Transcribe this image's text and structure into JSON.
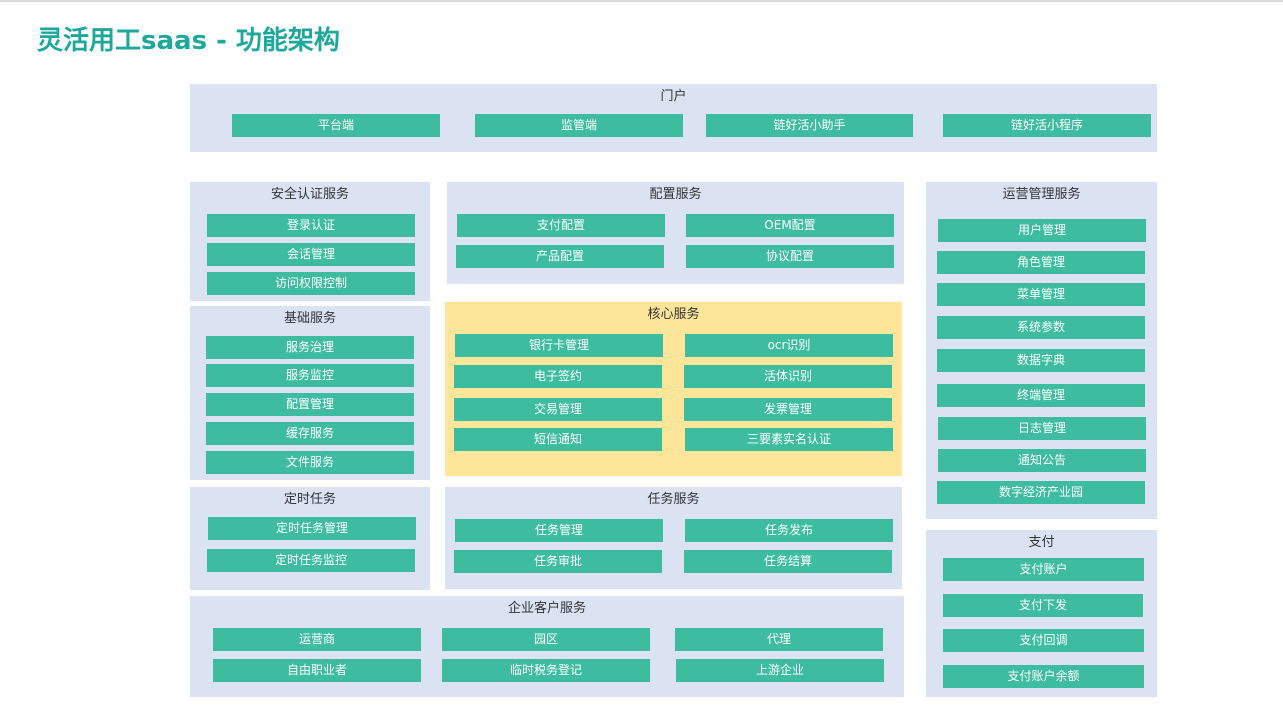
{
  "title": "灵活用工saas - 功能架构",
  "colors": {
    "title": "#1ea89c",
    "panel": "#dbe3f3",
    "core_panel": "#fde69a",
    "module": "#3dbca0"
  },
  "portal": {
    "title": "门户",
    "items": [
      "平台端",
      "监管端",
      "链好活小助手",
      "链好活小程序"
    ]
  },
  "security": {
    "title": "安全认证服务",
    "items": [
      "登录认证",
      "会话管理",
      "访问权限控制"
    ]
  },
  "config": {
    "title": "配置服务",
    "items": [
      "支付配置",
      "OEM配置",
      "产品配置",
      "协议配置"
    ]
  },
  "ops": {
    "title": "运营管理服务",
    "items": [
      "用户管理",
      "角色管理",
      "菜单管理",
      "系统参数",
      "数据字典",
      "终端管理",
      "日志管理",
      "通知公告",
      "数字经济产业园"
    ]
  },
  "base": {
    "title": "基础服务",
    "items": [
      "服务治理",
      "服务监控",
      "配置管理",
      "缓存服务",
      "文件服务"
    ]
  },
  "core": {
    "title": "核心服务",
    "items": [
      "银行卡管理",
      "ocr识别",
      "电子签约",
      "活体识别",
      "交易管理",
      "发票管理",
      "短信通知",
      "三要素实名认证"
    ]
  },
  "timer": {
    "title": "定时任务",
    "items": [
      "定时任务管理",
      "定时任务监控"
    ]
  },
  "task": {
    "title": "任务服务",
    "items": [
      "任务管理",
      "任务发布",
      "任务审批",
      "任务结算"
    ]
  },
  "pay": {
    "title": "支付",
    "items": [
      "支付账户",
      "支付下发",
      "支付回调",
      "支付账户余额"
    ]
  },
  "enterprise": {
    "title": "企业客户服务",
    "items": [
      "运营商",
      "园区",
      "代理",
      "自由职业者",
      "临时税务登记",
      "上游企业"
    ]
  }
}
